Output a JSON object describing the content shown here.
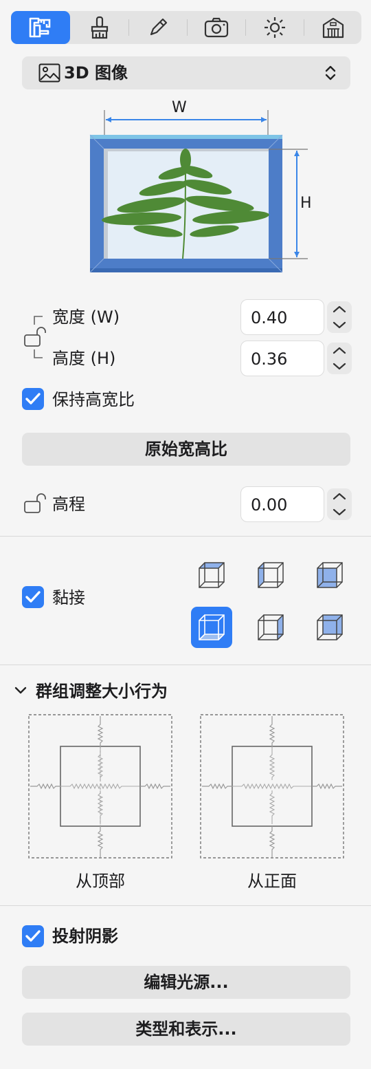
{
  "tabs": [
    {
      "id": "object",
      "icon": "object-props-icon",
      "active": true
    },
    {
      "id": "materials",
      "icon": "paintbrush-icon",
      "active": false
    },
    {
      "id": "edit",
      "icon": "pencil-icon",
      "active": false
    },
    {
      "id": "camera",
      "icon": "camera-icon",
      "active": false
    },
    {
      "id": "light",
      "icon": "sun-icon",
      "active": false
    },
    {
      "id": "building",
      "icon": "building-icon",
      "active": false
    }
  ],
  "type_popup": {
    "label": "3D 图像",
    "icon": "image-icon"
  },
  "diagram": {
    "width_label": "W",
    "height_label": "H"
  },
  "size": {
    "width_label": "宽度 (W)",
    "width_value": "0.40",
    "height_label": "高度 (H)",
    "height_value": "0.36"
  },
  "keep_ratio": {
    "label": "保持高宽比",
    "checked": true
  },
  "original_ratio_button": "原始宽高比",
  "elevation": {
    "label": "高程",
    "value": "0.00"
  },
  "snap": {
    "label": "黏接",
    "checked": true,
    "selected_index": 3
  },
  "group_resize": {
    "title": "群组调整大小行为",
    "from_top": "从顶部",
    "from_front": "从正面"
  },
  "cast_shadow": {
    "label": "投射阴影",
    "checked": true
  },
  "edit_light_button": "编辑光源...",
  "type_display_button": "类型和表示...",
  "colors": {
    "accent": "#2f7df5",
    "frame": "#4d7dc8"
  }
}
